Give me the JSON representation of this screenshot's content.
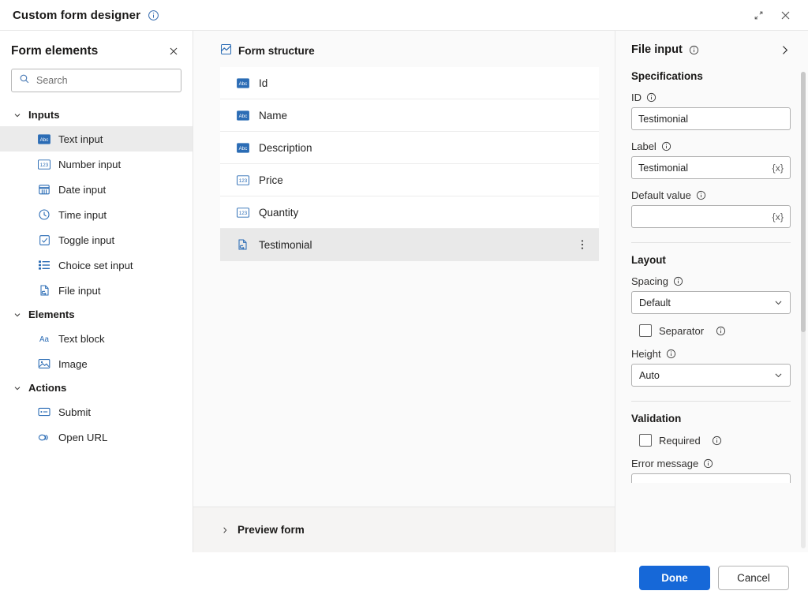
{
  "window": {
    "title": "Custom form designer",
    "title_info_icon": "info-icon",
    "expand_icon": "expand-diagonal-icon",
    "close_icon": "close-icon"
  },
  "sidebar": {
    "title": "Form elements",
    "close_icon": "close-icon",
    "search": {
      "placeholder": "Search",
      "value": "",
      "icon": "search-icon"
    },
    "groups": [
      {
        "label": "Inputs",
        "expanded": true,
        "items": [
          {
            "label": "Text input",
            "icon": "abc-text-icon",
            "selected": true
          },
          {
            "label": "Number input",
            "icon": "123-number-icon",
            "selected": false
          },
          {
            "label": "Date input",
            "icon": "calendar-icon",
            "selected": false
          },
          {
            "label": "Time input",
            "icon": "clock-icon",
            "selected": false
          },
          {
            "label": "Toggle input",
            "icon": "checkbox-icon",
            "selected": false
          },
          {
            "label": "Choice set input",
            "icon": "list-icon",
            "selected": false
          },
          {
            "label": "File input",
            "icon": "file-icon",
            "selected": false
          }
        ]
      },
      {
        "label": "Elements",
        "expanded": true,
        "items": [
          {
            "label": "Text block",
            "icon": "aa-text-icon",
            "selected": false
          },
          {
            "label": "Image",
            "icon": "image-icon",
            "selected": false
          }
        ]
      },
      {
        "label": "Actions",
        "expanded": true,
        "items": [
          {
            "label": "Submit",
            "icon": "submit-button-icon",
            "selected": false
          },
          {
            "label": "Open URL",
            "icon": "link-icon",
            "selected": false
          }
        ]
      }
    ]
  },
  "center": {
    "structure_title": "Form structure",
    "structure_icon": "form-structure-icon",
    "rows": [
      {
        "label": "Id",
        "icon": "abc-text-icon",
        "selected": false
      },
      {
        "label": "Name",
        "icon": "abc-text-icon",
        "selected": false
      },
      {
        "label": "Description",
        "icon": "abc-text-icon",
        "selected": false
      },
      {
        "label": "Price",
        "icon": "123-number-icon",
        "selected": false
      },
      {
        "label": "Quantity",
        "icon": "123-number-icon",
        "selected": false
      },
      {
        "label": "Testimonial",
        "icon": "file-icon",
        "selected": true
      }
    ],
    "preview": {
      "label": "Preview form",
      "chevron_icon": "chevron-right-icon",
      "expanded": false
    }
  },
  "rightpanel": {
    "title": "File input",
    "title_info_icon": "info-icon",
    "collapse_icon": "chevron-right-icon",
    "sections": {
      "specifications": {
        "title": "Specifications",
        "id": {
          "label": "ID",
          "value": "Testimonial",
          "info_icon": "info-icon"
        },
        "label_field": {
          "label": "Label",
          "value": "Testimonial",
          "token": "{x}",
          "info_icon": "info-icon"
        },
        "default_value": {
          "label": "Default value",
          "value": "",
          "token": "{x}",
          "info_icon": "info-icon"
        }
      },
      "layout": {
        "title": "Layout",
        "spacing": {
          "label": "Spacing",
          "value": "Default",
          "info_icon": "info-icon",
          "caret_icon": "chevron-down-icon"
        },
        "separator": {
          "label": "Separator",
          "checked": false,
          "info_icon": "info-icon"
        },
        "height": {
          "label": "Height",
          "value": "Auto",
          "info_icon": "info-icon",
          "caret_icon": "chevron-down-icon"
        }
      },
      "validation": {
        "title": "Validation",
        "required": {
          "label": "Required",
          "checked": false,
          "info_icon": "info-icon"
        },
        "error_message": {
          "label": "Error message",
          "value": "",
          "info_icon": "info-icon"
        }
      }
    }
  },
  "footer": {
    "done_label": "Done",
    "cancel_label": "Cancel"
  },
  "colors": {
    "accent_blue": "#1668d8",
    "icon_blue": "#2b6cb5",
    "selection_gray": "#e9e9e9",
    "panel_bg": "#fafafa"
  }
}
